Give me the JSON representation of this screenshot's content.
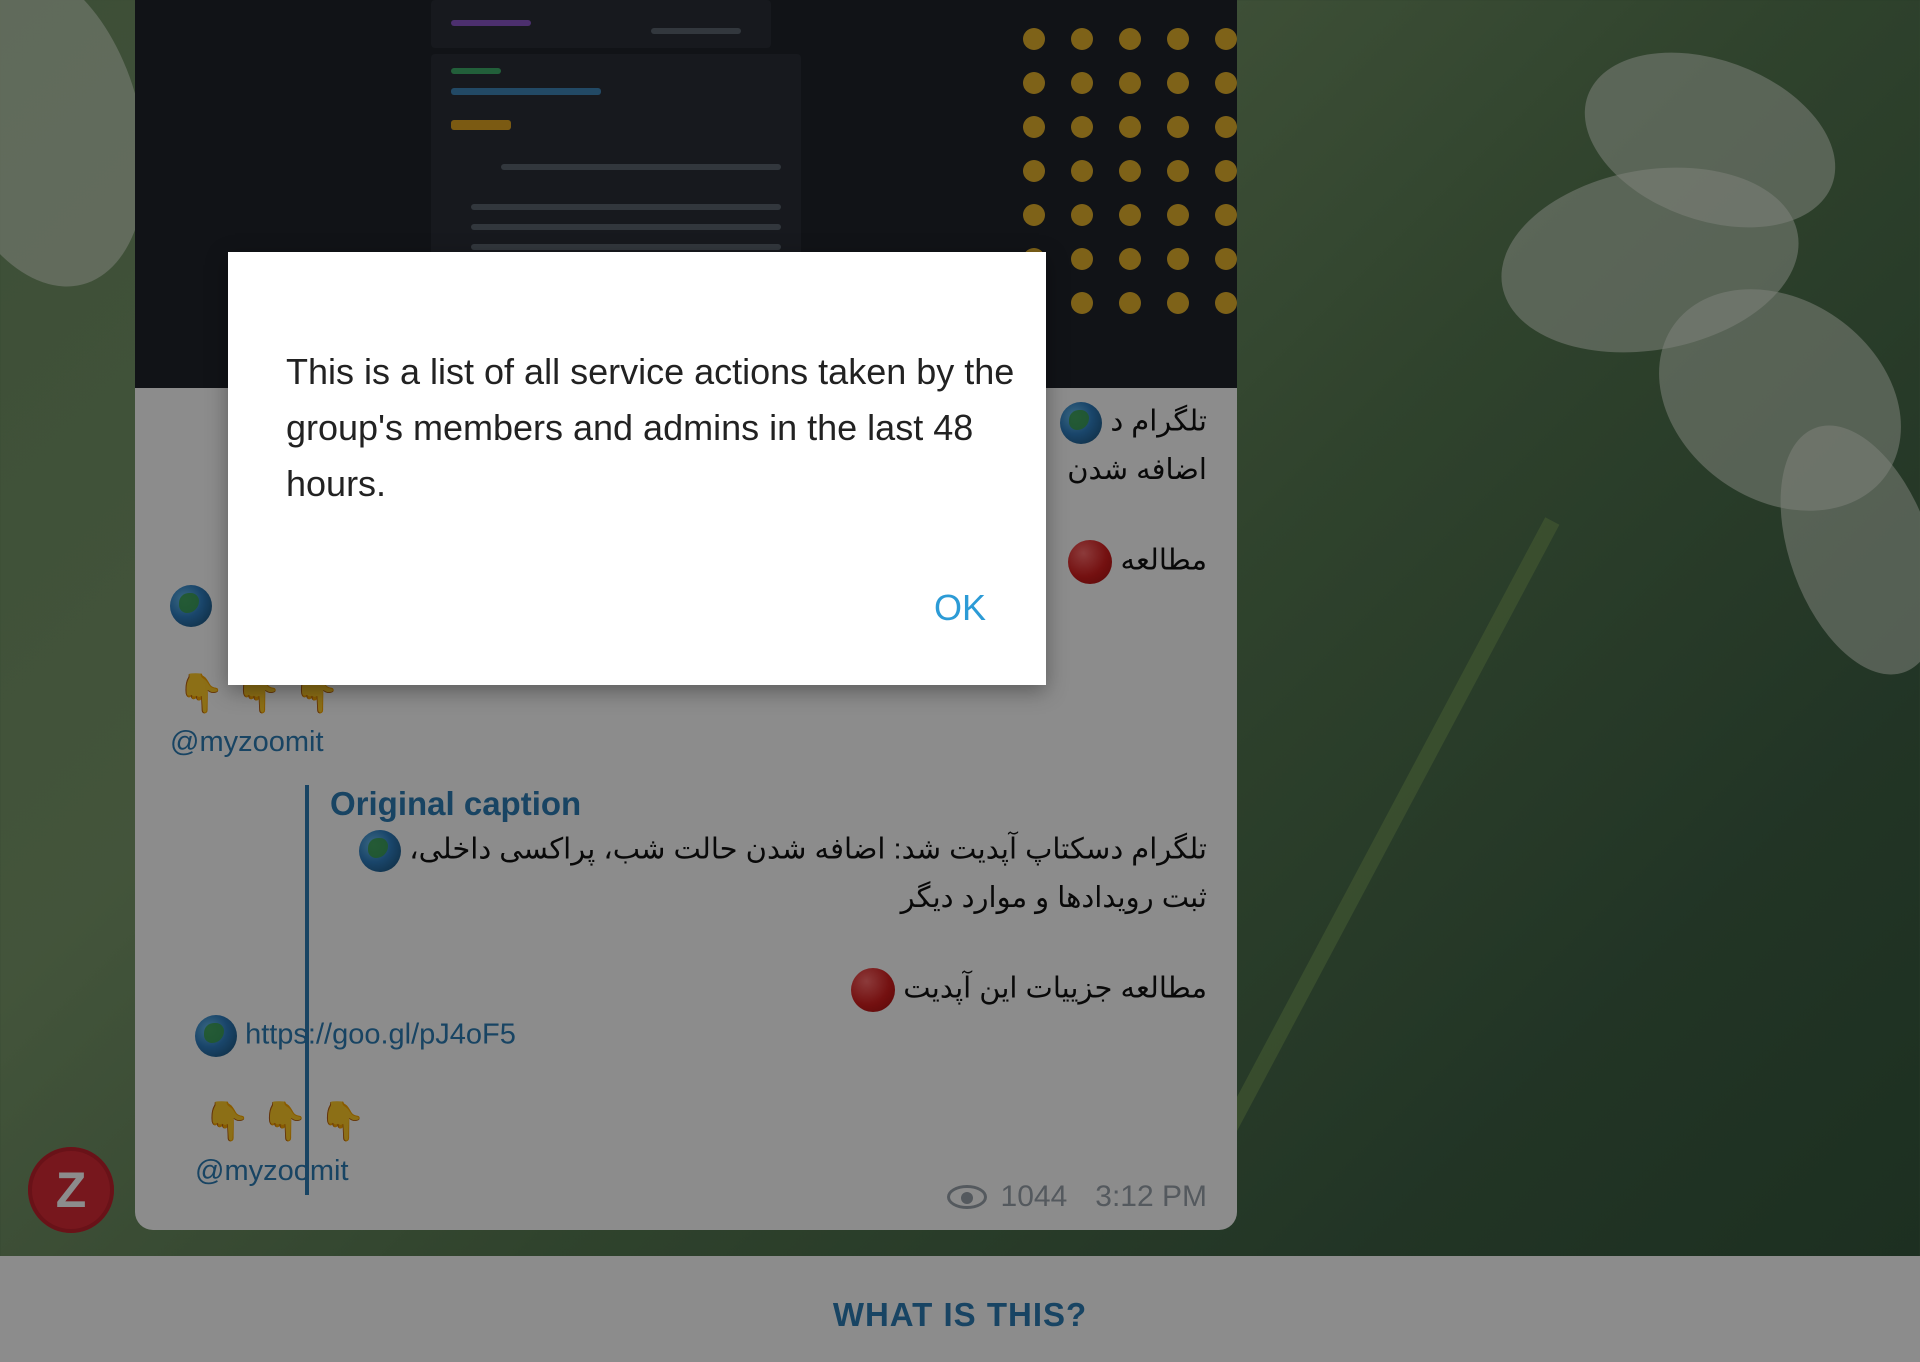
{
  "message": {
    "line1_text": "تلگرام د",
    "line1b_text": "اضافه شدن",
    "line2_text": "مطالعه",
    "handle": "@myzoomit",
    "original_caption_label": "Original caption",
    "caption_line1": "تلگرام دسکتاپ آپدیت شد: اضافه شدن حالت شب، پراکسی داخلی،",
    "caption_line2": "ثبت رویدادها و موارد دیگر",
    "caption_line3": "مطالعه جزییات این آپدیت",
    "caption_link": "https://goo.gl/pJ4oF5",
    "caption_handle": "@myzoomit",
    "views": "1044",
    "time": "3:12 PM",
    "hands": "👇 👇 👇"
  },
  "dialog": {
    "text": "This is a list of all service actions taken by the group's members and admins in the last 48 hours.",
    "ok_label": "OK"
  },
  "bottom_bar": {
    "label": "WHAT IS THIS?"
  },
  "avatar": {
    "letter": "Z",
    "color": "#d92b36"
  },
  "colors": {
    "accent": "#2c7db4",
    "dialog_button": "#2c9bd6"
  },
  "icons": [
    "globe-icon",
    "red-circle-icon",
    "eye-icon",
    "pointing-down-icon"
  ]
}
